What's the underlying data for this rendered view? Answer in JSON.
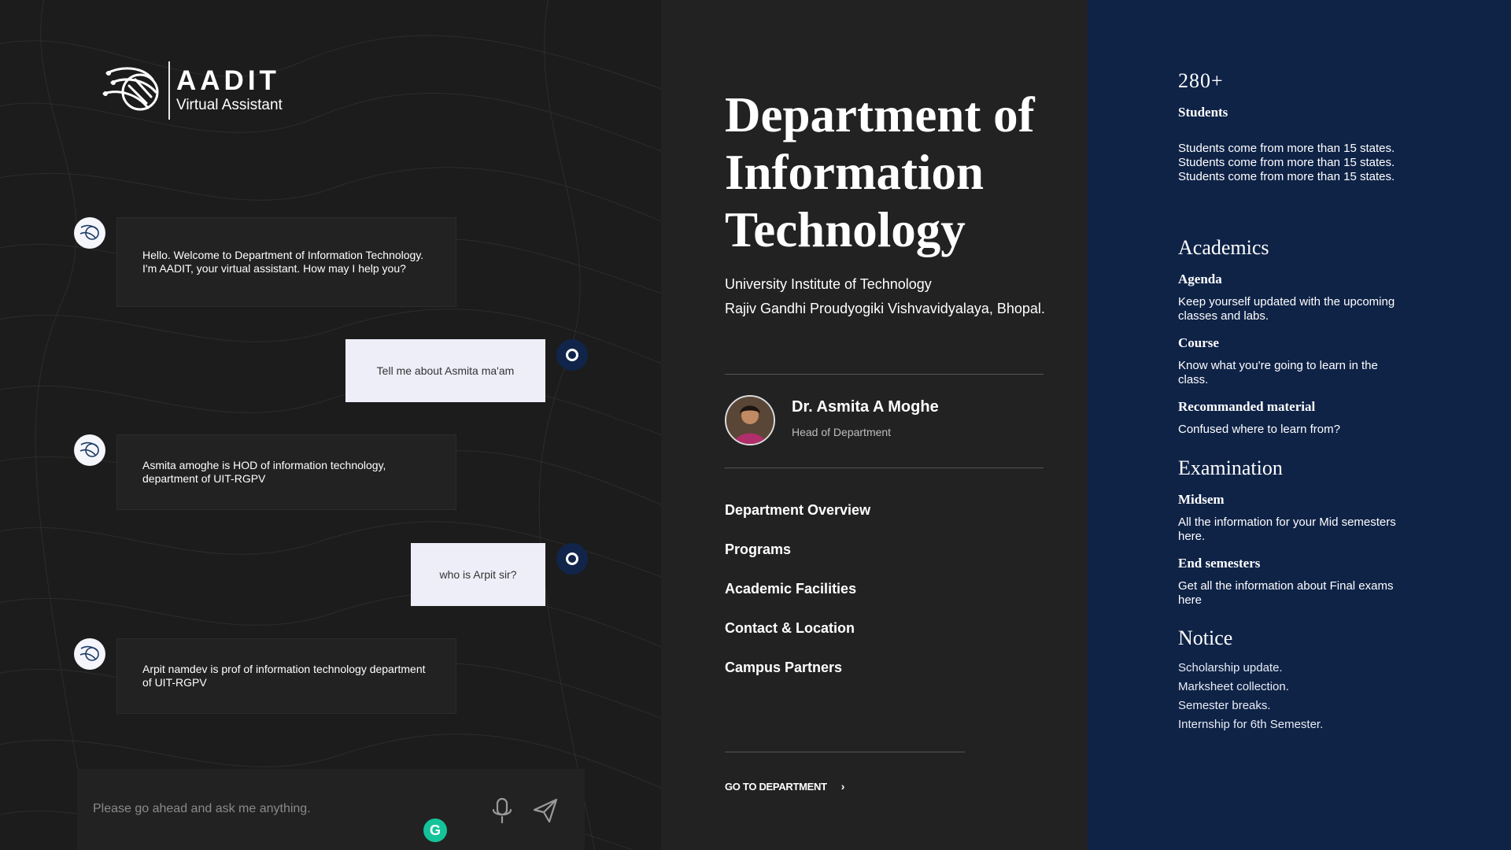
{
  "brand": {
    "name": "AADIT",
    "tagline": "Virtual Assistant"
  },
  "chat": {
    "messages": [
      {
        "from": "bot",
        "text": "Hello. Welcome to Department of Information Technology. I'm AADIT, your virtual assistant. How may I help you?"
      },
      {
        "from": "user",
        "text": "Tell me about Asmita ma'am"
      },
      {
        "from": "bot",
        "text": "Asmita amoghe is HOD of information technology, department of UIT-RGPV"
      },
      {
        "from": "user",
        "text": "who is Arpit sir?"
      },
      {
        "from": "bot",
        "text": "Arpit namdev is prof of information technology department of UIT-RGPV"
      }
    ],
    "input_placeholder": "Please go ahead and ask me anything.",
    "grammar_badge": "G"
  },
  "department": {
    "title": "Department of Information Technology",
    "institute": "University Institute of Technology",
    "university": "Rajiv Gandhi Proudyogiki Vishvavidyalaya, Bhopal.",
    "hod": {
      "name": "Dr. Asmita A Moghe",
      "role": "Head of Department"
    },
    "nav": [
      "Department Overview",
      "Programs",
      "Academic Facilities",
      "Contact & Location",
      "Campus Partners"
    ],
    "go_link": "GO TO DEPARTMENT",
    "go_chevron": "›"
  },
  "info": {
    "stat_value": "280+",
    "stat_label": "Students",
    "stat_desc": "Students come from more than 15 states. Students come from more than 15 states. Students come from more than 15 states.",
    "academics": {
      "heading": "Academics",
      "items": [
        {
          "title": "Agenda",
          "desc": "Keep yourself updated with the upcoming classes and labs."
        },
        {
          "title": "Course",
          "desc": "Know what you're going to learn in the class."
        },
        {
          "title": "Recommanded material",
          "desc": "Confused where to learn from?"
        }
      ]
    },
    "examination": {
      "heading": "Examination",
      "items": [
        {
          "title": "Midsem",
          "desc": "All the information for your Mid semesters here."
        },
        {
          "title": "End semesters",
          "desc": "Get all the information about Final exams here"
        }
      ]
    },
    "notice": {
      "heading": "Notice",
      "items": [
        "Scholarship update.",
        "Marksheet collection.",
        "Semester breaks.",
        "Internship for 6th Semester."
      ]
    }
  },
  "colors": {
    "chat_bg": "#1c1c1c",
    "dept_bg": "#222222",
    "info_bg": "#0f2347",
    "user_bubble": "#eeeef9",
    "user_dot": "#11254a",
    "grammar": "#15c39a"
  },
  "icons": {
    "mic": "microphone-icon",
    "send": "send-icon",
    "bot": "aadit-bot-icon",
    "user": "user-ring-icon"
  }
}
